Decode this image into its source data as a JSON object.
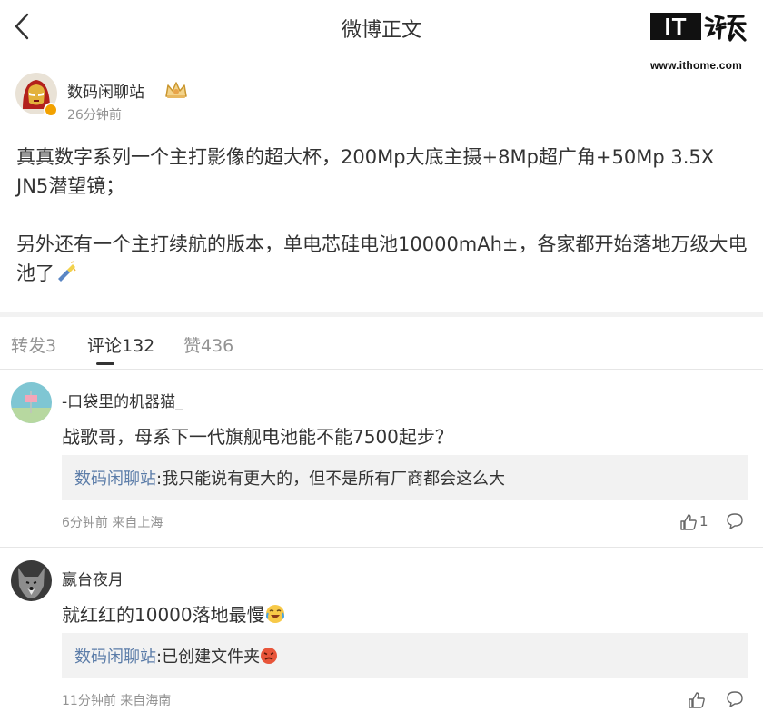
{
  "header": {
    "title": "微博正文",
    "logo_text": "IT",
    "logo_seal_text": "之家",
    "logo_url": "www.ithome.com"
  },
  "post": {
    "author": "数码闲聊站",
    "time": "26分钟前",
    "paragraph_1": "真真数字系列一个主打影像的超大杯，200Mp大底主摄+8Mp超广角+50Mp 3.5X JN5潜望镜；",
    "paragraph_2": "另外还有一个主打续航的版本，单电芯硅电池10000mAh±，各家都开始落地万级大电池了"
  },
  "tabs": [
    {
      "label": "转发3"
    },
    {
      "label": "评论132"
    },
    {
      "label": "赞436"
    }
  ],
  "comments": [
    {
      "author": "-口袋里的机器猫_",
      "text": "战歌哥，母系下一代旗舰电池能不能7500起步？",
      "reply_author": "数码闲聊站",
      "reply_text": ":我只能说有更大的，但不是所有厂商都会这么大",
      "meta": "6分钟前 来自上海",
      "likes": "1"
    },
    {
      "author": "嬴台夜月",
      "text": "就红红的10000落地最慢",
      "reply_author": "数码闲聊站",
      "reply_text": ":已创建文件夹",
      "meta": "11分钟前 来自海南",
      "likes": ""
    }
  ],
  "icons": {
    "back": "chevron-left-icon",
    "crown": "crown-badge-icon",
    "verified": "verified-badge-icon",
    "like": "thumbs-up-icon",
    "reply": "comment-bubble-icon"
  },
  "colors": {
    "link": "#5b7ca8",
    "muted": "#939393",
    "text": "#333333",
    "reply_bg": "#f2f2f2",
    "verified": "#f2a100"
  }
}
